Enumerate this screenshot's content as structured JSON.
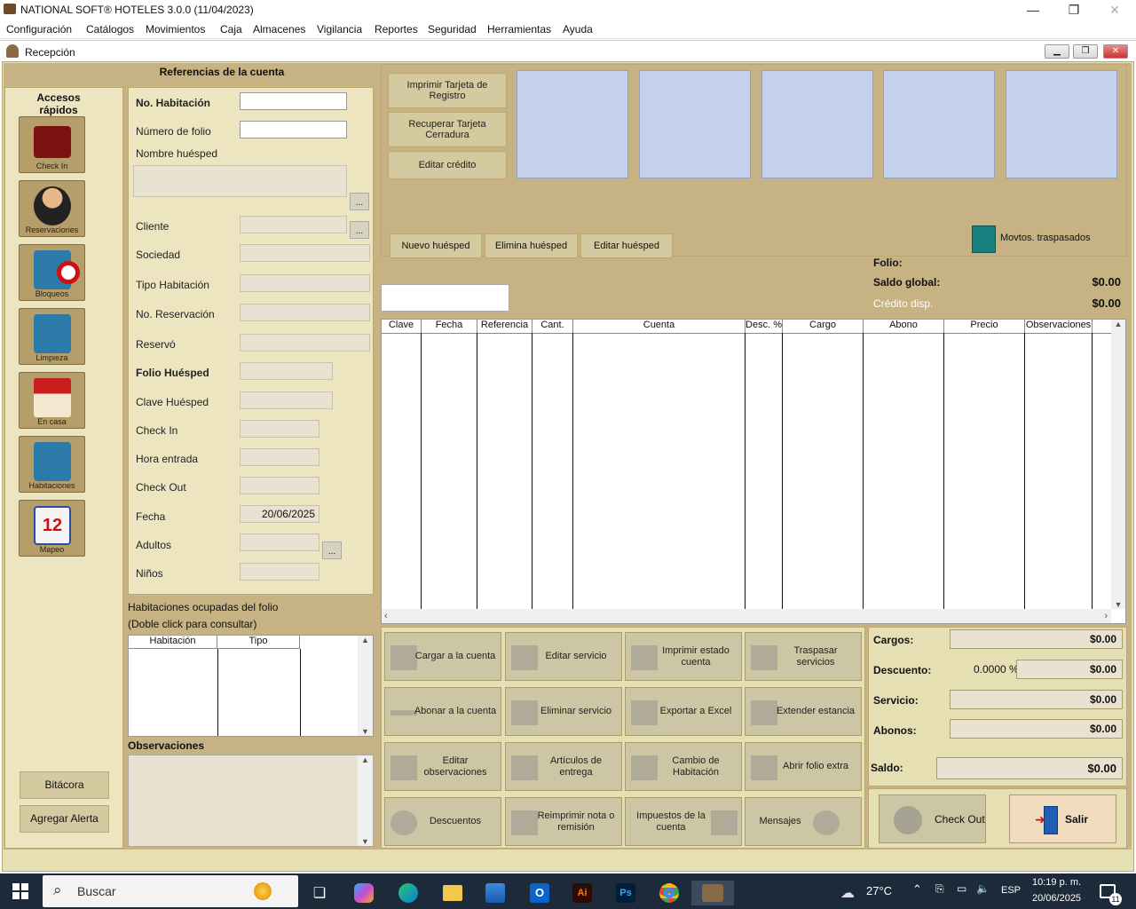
{
  "window": {
    "title": "NATIONAL SOFT® HOTELES 3.0.0 (11/04/2023)",
    "minimize": "—",
    "maximize": "❐",
    "close": "✕"
  },
  "menu": [
    "Configuración",
    "Catálogos",
    "Movimientos",
    "Caja",
    "Almacenes",
    "Vigilancia",
    "Reportes",
    "Seguridad",
    "Herramientas",
    "Ayuda"
  ],
  "mdi": {
    "title": "Recepción"
  },
  "quick": {
    "title": "Accesos rápidos",
    "items": [
      "Check In",
      "Reservaciones",
      "Bloqueos",
      "Limpieza",
      "En casa",
      "Habitaciones",
      "Mapeo"
    ],
    "bitacora": "Bitácora",
    "alerta": "Agregar Alerta"
  },
  "ref": {
    "header": "Referencias de la cuenta",
    "no_hab": "No. Habitación",
    "num_folio": "Número de folio",
    "nombre": "Nombre huésped",
    "cliente": "Cliente",
    "sociedad": "Sociedad",
    "tipo_hab": "Tipo Habitación",
    "no_res": "No. Reservación",
    "reservo": "Reservó",
    "folio_hue": "Folio Huésped",
    "clave_hue": "Clave Huésped",
    "checkin": "Check In",
    "hora": "Hora entrada",
    "checkout": "Check Out",
    "fecha": "Fecha",
    "fecha_val": "20/06/2025",
    "adultos": "Adultos",
    "ninos": "Niños",
    "dots": "..."
  },
  "rooms": {
    "title1": "Habitaciones ocupadas del folio",
    "title2": "(Doble click para consultar)",
    "cols": [
      "Habitación",
      "Tipo"
    ]
  },
  "obs": {
    "title": "Observaciones"
  },
  "top": {
    "imprimir": "Imprimir Tarjeta de Registro",
    "recuperar": "Recuperar Tarjeta Cerradura",
    "editar_credito": "Editar crédito",
    "nuevo": "Nuevo huésped",
    "elimina": "Elimina huésped",
    "editar": "Editar huésped",
    "movtos": "Movtos. traspasados"
  },
  "folio": {
    "folio": "Folio:",
    "saldo": "Saldo global:",
    "saldo_val": "$0.00",
    "credito": "Crédito disp.",
    "credito_val": "$0.00"
  },
  "grid": {
    "cols": [
      "Clave",
      "Fecha",
      "Referencia",
      "Cant.",
      "Cuenta",
      "Desc. %",
      "Cargo",
      "Abono",
      "Precio",
      "Observaciones"
    ]
  },
  "actions": [
    [
      "Cargar a la cuenta",
      "Editar servicio",
      "Imprimir estado cuenta",
      "Traspasar servicios"
    ],
    [
      "Abonar a la cuenta",
      "Eliminar servicio",
      "Exportar a Excel",
      "Extender estancia"
    ],
    [
      "Editar observaciones",
      "Artículos de entrega",
      "Cambio de Habitación",
      "Abrir folio extra"
    ],
    [
      "Descuentos",
      "Reimprimir nota o remisión",
      "Impuestos de la cuenta",
      "Mensajes"
    ]
  ],
  "totals": {
    "cargos": "Cargos:",
    "cargos_val": "$0.00",
    "descuento": "Descuento:",
    "pct": "0.0000 %",
    "descuento_val": "$0.00",
    "servicio": "Servicio:",
    "servicio_val": "$0.00",
    "abonos": "Abonos:",
    "abonos_val": "$0.00",
    "saldo": "Saldo:",
    "saldo_val": "$0.00",
    "checkout": "Check Out",
    "salir": "Salir"
  },
  "taskbar": {
    "search": "Buscar",
    "temp": "27°C",
    "lang": "ESP",
    "time": "10:19 p. m.",
    "date": "20/06/2025",
    "notif": "11"
  }
}
